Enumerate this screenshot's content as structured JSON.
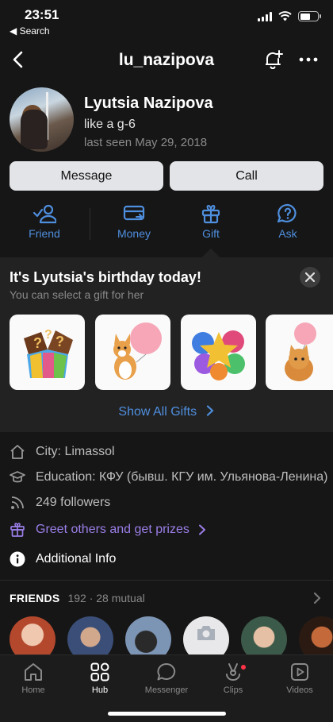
{
  "status_bar": {
    "time": "23:51",
    "back_app": "◀ Search"
  },
  "header": {
    "username": "lu_nazipova"
  },
  "profile": {
    "name": "Lyutsia Nazipova",
    "status": "like a g-6",
    "last_seen": "last seen May 29, 2018"
  },
  "buttons": {
    "message": "Message",
    "call": "Call"
  },
  "actions": [
    {
      "label": "Friend",
      "icon": "add-friend-icon"
    },
    {
      "label": "Money",
      "icon": "money-transfer-icon"
    },
    {
      "label": "Gift",
      "icon": "gift-icon"
    },
    {
      "label": "Ask",
      "icon": "question-bubble-icon"
    }
  ],
  "birthday": {
    "title": "It's Lyutsia's birthday today!",
    "subtitle": "You can select a gift for her",
    "gifts": [
      {
        "name": "mystery-gift-box"
      },
      {
        "name": "corgi-with-balloon"
      },
      {
        "name": "birthday-balloons"
      },
      {
        "name": "cat-with-balloon"
      }
    ],
    "show_all": "Show All Gifts"
  },
  "info": {
    "city": "City: Limassol",
    "education": "Education: КФУ (бывш. КГУ им. Ульянова-Ленина)",
    "followers": "249 followers",
    "greet": "Greet others and get prizes",
    "additional": "Additional Info"
  },
  "friends": {
    "title": "FRIENDS",
    "count": "192 · 28 mutual"
  },
  "tabbar": [
    {
      "label": "Home",
      "active": false
    },
    {
      "label": "Hub",
      "active": true
    },
    {
      "label": "Messenger",
      "active": false
    },
    {
      "label": "Clips",
      "active": false
    },
    {
      "label": "Videos",
      "active": false
    }
  ],
  "colors": {
    "background": "#161616",
    "accent_blue": "#4f8fdf",
    "accent_purple": "#9b7ee8",
    "button_bg": "#e3e4e8",
    "notification_dot": "#ff3347"
  }
}
